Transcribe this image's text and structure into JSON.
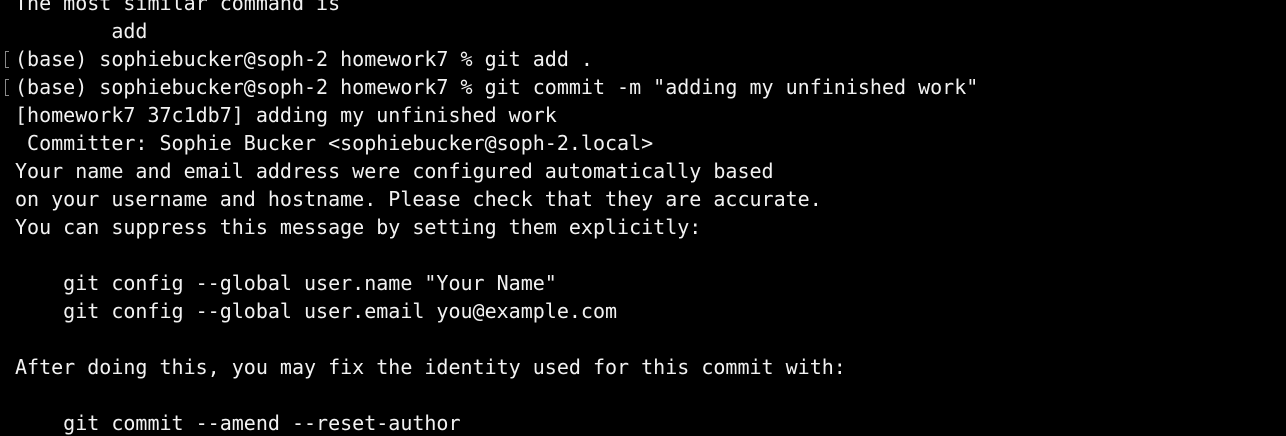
{
  "terminal": {
    "lines": [
      {
        "text": "The most similar command is",
        "prompt": false
      },
      {
        "text": "        add",
        "prompt": false
      },
      {
        "text": "(base) sophiebucker@soph-2 homework7 % git add .",
        "prompt": true
      },
      {
        "text": "(base) sophiebucker@soph-2 homework7 % git commit -m \"adding my unfinished work\"",
        "prompt": true
      },
      {
        "text": "[homework7 37c1db7] adding my unfinished work",
        "prompt": false
      },
      {
        "text": " Committer: Sophie Bucker <sophiebucker@soph-2.local>",
        "prompt": false
      },
      {
        "text": "Your name and email address were configured automatically based",
        "prompt": false
      },
      {
        "text": "on your username and hostname. Please check that they are accurate.",
        "prompt": false
      },
      {
        "text": "You can suppress this message by setting them explicitly:",
        "prompt": false
      },
      {
        "text": "",
        "prompt": false
      },
      {
        "text": "    git config --global user.name \"Your Name\"",
        "prompt": false
      },
      {
        "text": "    git config --global user.email you@example.com",
        "prompt": false
      },
      {
        "text": "",
        "prompt": false
      },
      {
        "text": "After doing this, you may fix the identity used for this commit with:",
        "prompt": false
      },
      {
        "text": "",
        "prompt": false
      },
      {
        "text": "    git commit --amend --reset-author",
        "prompt": false
      }
    ]
  },
  "colors": {
    "background": "#000000",
    "foreground": "#f2f2f2",
    "prompt_marker": "#8a8a8a"
  }
}
